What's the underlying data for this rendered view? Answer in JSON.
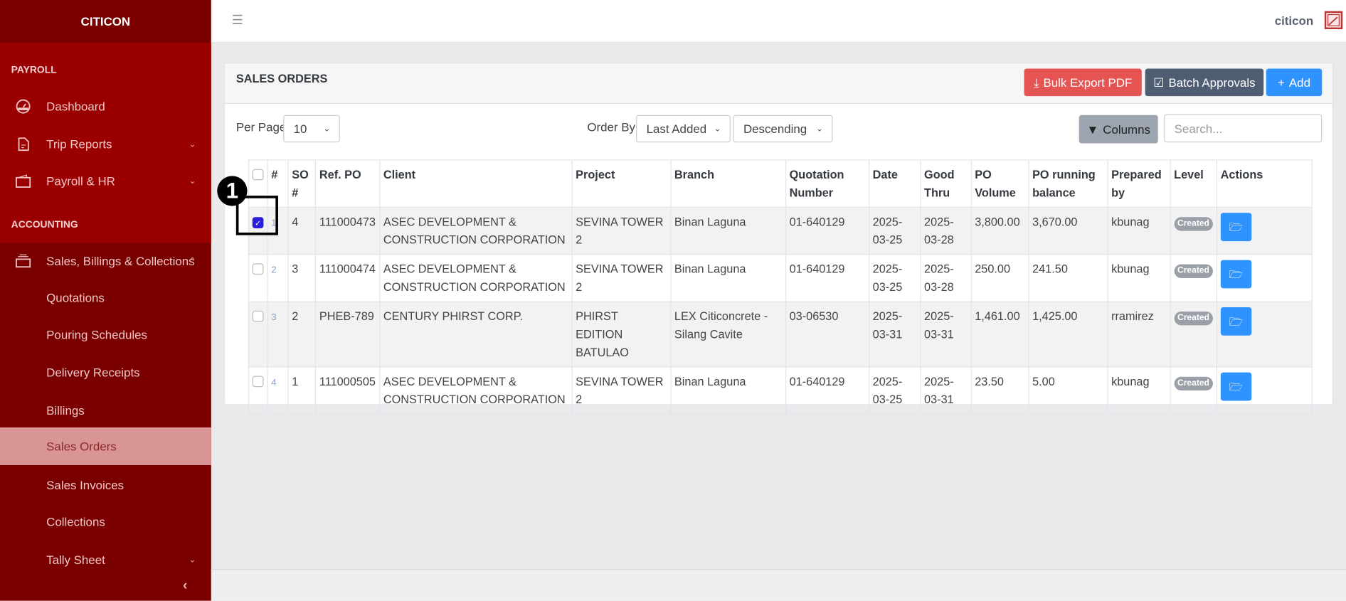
{
  "sidebar": {
    "brand": "CITICON",
    "sections": [
      "PAYROLL",
      "ACCOUNTING"
    ],
    "items": [
      {
        "label": "Dashboard",
        "icon": "gauge-icon"
      },
      {
        "label": "Trip Reports",
        "icon": "document-icon"
      },
      {
        "label": "Payroll & HR",
        "icon": "wallet-icon"
      },
      {
        "label": "Sales, Billings & Collections",
        "icon": "tray-icon"
      }
    ],
    "subitems": [
      "Quotations",
      "Pouring Schedules",
      "Delivery Receipts",
      "Billings",
      "Sales Orders",
      "Sales Invoices",
      "Collections",
      "Tally Sheet"
    ],
    "active": "Sales Orders"
  },
  "header": {
    "user": "citicon"
  },
  "panel": {
    "title": "SALES ORDERS",
    "bulk_export": "Bulk Export PDF",
    "batch_approvals": "Batch Approvals",
    "add": "Add",
    "per_page_label": "Per Page",
    "per_page": "10",
    "order_by_label": "Order By",
    "order_by": "Last Added",
    "direction": "Descending",
    "columns": "Columns",
    "search_placeholder": "Search..."
  },
  "table": {
    "headers": [
      "#",
      "SO #",
      "Ref. PO",
      "Client",
      "Project",
      "Branch",
      "Quotation Number",
      "Date",
      "Good Thru",
      "PO Volume",
      "PO running balance",
      "Prepared by",
      "Level",
      "Actions"
    ],
    "rows": [
      {
        "n": "1",
        "so": "4",
        "ref": "111000473",
        "client": "ASEC DEVELOPMENT & CONSTRUCTION CORPORATION",
        "project": "SEVINA TOWER 2",
        "branch": "Binan Laguna",
        "quote": "01-640129",
        "date": "2025-03-25",
        "good": "2025-03-28",
        "vol": "3,800.00",
        "bal": "3,670.00",
        "by": "kbunag",
        "level": "Created",
        "checked": true
      },
      {
        "n": "2",
        "so": "3",
        "ref": "111000474",
        "client": "ASEC DEVELOPMENT & CONSTRUCTION CORPORATION",
        "project": "SEVINA TOWER 2",
        "branch": "Binan Laguna",
        "quote": "01-640129",
        "date": "2025-03-25",
        "good": "2025-03-28",
        "vol": "250.00",
        "bal": "241.50",
        "by": "kbunag",
        "level": "Created",
        "checked": false
      },
      {
        "n": "3",
        "so": "2",
        "ref": "PHEB-789",
        "client": "CENTURY PHIRST CORP.",
        "project": "PHIRST EDITION BATULAO",
        "branch": "LEX Citiconcrete - Silang Cavite",
        "quote": "03-06530",
        "date": "2025-03-31",
        "good": "2025-03-31",
        "vol": "1,461.00",
        "bal": "1,425.00",
        "by": "rramirez",
        "level": "Created",
        "checked": false
      },
      {
        "n": "4",
        "so": "1",
        "ref": "111000505",
        "client": "ASEC DEVELOPMENT & CONSTRUCTION CORPORATION",
        "project": "SEVINA TOWER 2",
        "branch": "Binan Laguna",
        "quote": "01-640129",
        "date": "2025-03-25",
        "good": "2025-03-31",
        "vol": "23.50",
        "bal": "5.00",
        "by": "kbunag",
        "level": "Created",
        "checked": false
      }
    ]
  },
  "annotation": {
    "step": "1"
  },
  "colors": {
    "sidebar": "#7a0000",
    "sidebar_red": "#9b0000",
    "active": "#d99595",
    "danger": "#e55353",
    "dark": "#4f5d73",
    "primary": "#2f93ff"
  }
}
